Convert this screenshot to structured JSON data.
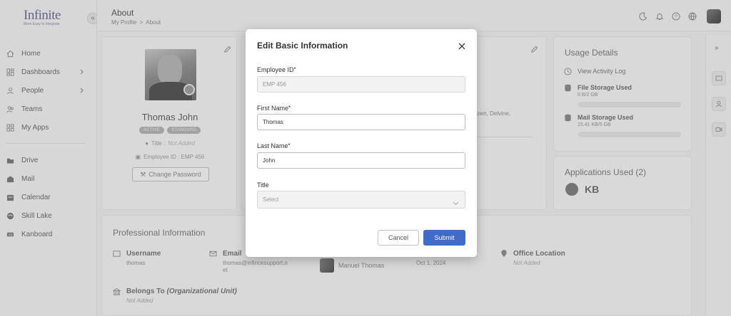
{
  "app": {
    "logo_text": "Infinite",
    "logo_tagline": "More Easy to Integrate"
  },
  "sidebar": {
    "items": [
      {
        "label": "Home",
        "icon": "home-icon"
      },
      {
        "label": "Dashboards",
        "icon": "dashboard-icon",
        "has_children": true
      },
      {
        "label": "People",
        "icon": "people-icon",
        "has_children": true
      },
      {
        "label": "Teams",
        "icon": "teams-icon"
      },
      {
        "label": "My Apps",
        "icon": "apps-icon"
      }
    ],
    "items2": [
      {
        "label": "Drive",
        "icon": "drive-icon"
      },
      {
        "label": "Mail",
        "icon": "mail-icon"
      },
      {
        "label": "Calendar",
        "icon": "calendar-icon"
      },
      {
        "label": "Skill Lake",
        "icon": "skill-lake-icon"
      },
      {
        "label": "Kanboard",
        "icon": "kanboard-icon"
      }
    ]
  },
  "header": {
    "title": "About",
    "breadcrumb": [
      "My Profile",
      "About"
    ]
  },
  "profile": {
    "name": "Thomas John",
    "badges": [
      "ACTIVE",
      "STANDARD"
    ],
    "title_label": "Title :",
    "title_value": "Not Added",
    "employee_id_line": "Employee ID : EMP 456",
    "change_password": "Change Password"
  },
  "contact": {
    "address_fragment": "own, Delvine,"
  },
  "usage": {
    "title": "Usage Details",
    "view_log": "View Activity Log",
    "file_storage_label": "File Storage Used",
    "file_storage_value": "0 B/2 GB",
    "file_storage_fraction": 0.0,
    "mail_storage_label": "Mail Storage Used",
    "mail_storage_value": "15.41 KB/5 GB",
    "mail_storage_fraction": 0.0
  },
  "apps_used": {
    "title": "Applications Used (2)",
    "app2": "KB"
  },
  "professional": {
    "title": "Professional Information",
    "username_label": "Username",
    "username_value": "thomas",
    "email_label": "Email",
    "email_value_1": "thomas@infincesupport.n",
    "email_value_2": "et",
    "manager_name": "Manuel Thomas",
    "join_date": "Oct 1, 2024",
    "office_label": "Office Location",
    "office_value": "Not Added",
    "belongs_label": "Belongs To",
    "belongs_label_em": "(Organizational Unit)",
    "belongs_value": "Not Added"
  },
  "modal": {
    "title": "Edit Basic Information",
    "employee_id_label": "Employee ID",
    "employee_id_value": "EMP 456",
    "first_name_label": "First Name",
    "first_name_value": "Thomas",
    "last_name_label": "Last Name",
    "last_name_value": "John",
    "title_label": "Title",
    "title_placeholder": "Select",
    "cancel": "Cancel",
    "submit": "Submit",
    "required_mark": "*"
  }
}
